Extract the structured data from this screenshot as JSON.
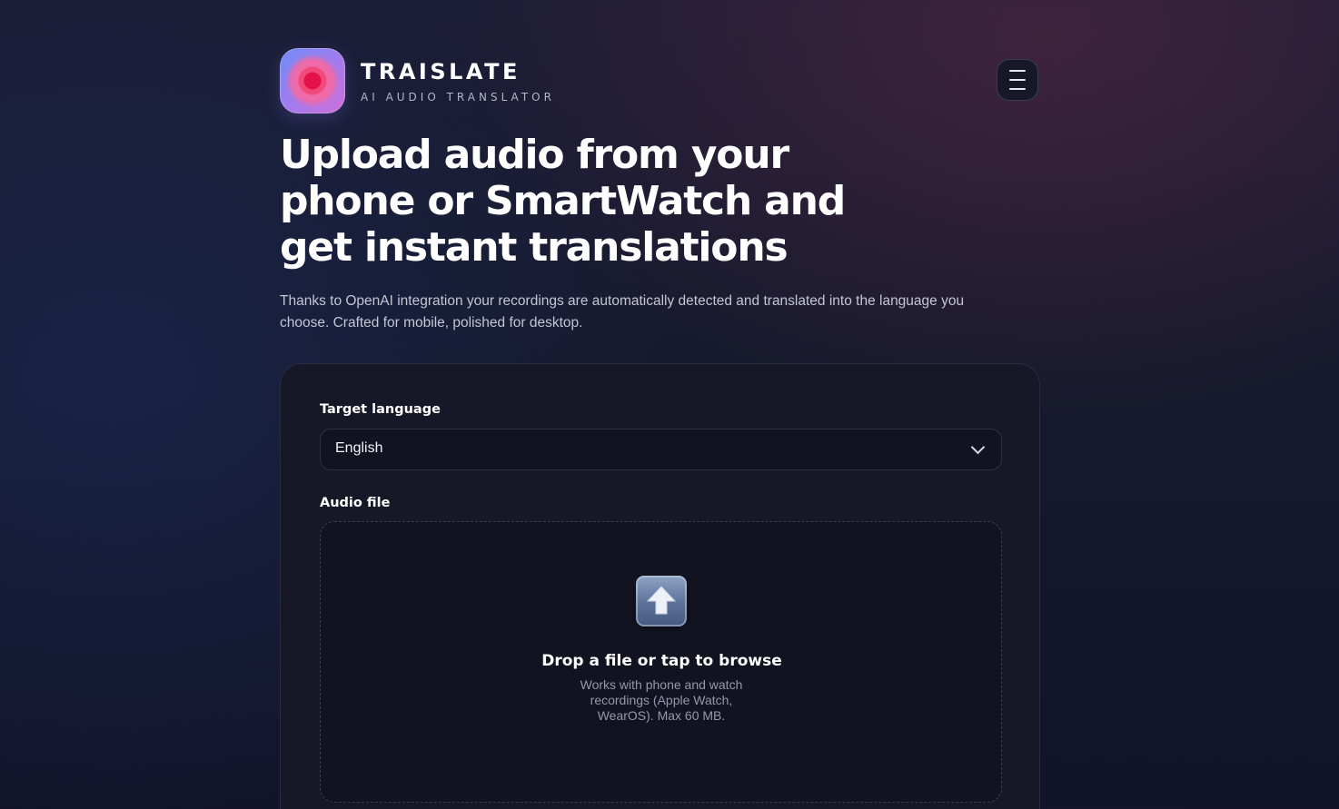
{
  "brand": {
    "name": "TRAISLATE",
    "tagline": "AI AUDIO TRANSLATOR"
  },
  "header": {
    "menu_icon": "hamburger-menu-icon"
  },
  "hero": {
    "title": "Upload audio from your phone or SmartWatch and get instant translations",
    "subtitle": "Thanks to OpenAI integration your recordings are automatically detected and translated into the language you choose. Crafted for mobile, polished for desktop."
  },
  "form": {
    "language_label": "Target language",
    "language_value": "English",
    "file_label": "Audio file",
    "dropzone": {
      "icon": "upload-arrow-icon",
      "title": "Drop a file or tap to browse",
      "hint": "Works with phone and watch recordings (Apple Watch, WearOS). Max 60 MB."
    }
  },
  "colors": {
    "background": "#171a2e",
    "card": "#171827",
    "accent_red": "#e4114a",
    "text_primary": "#ffffff",
    "text_muted": "#9598ac"
  }
}
